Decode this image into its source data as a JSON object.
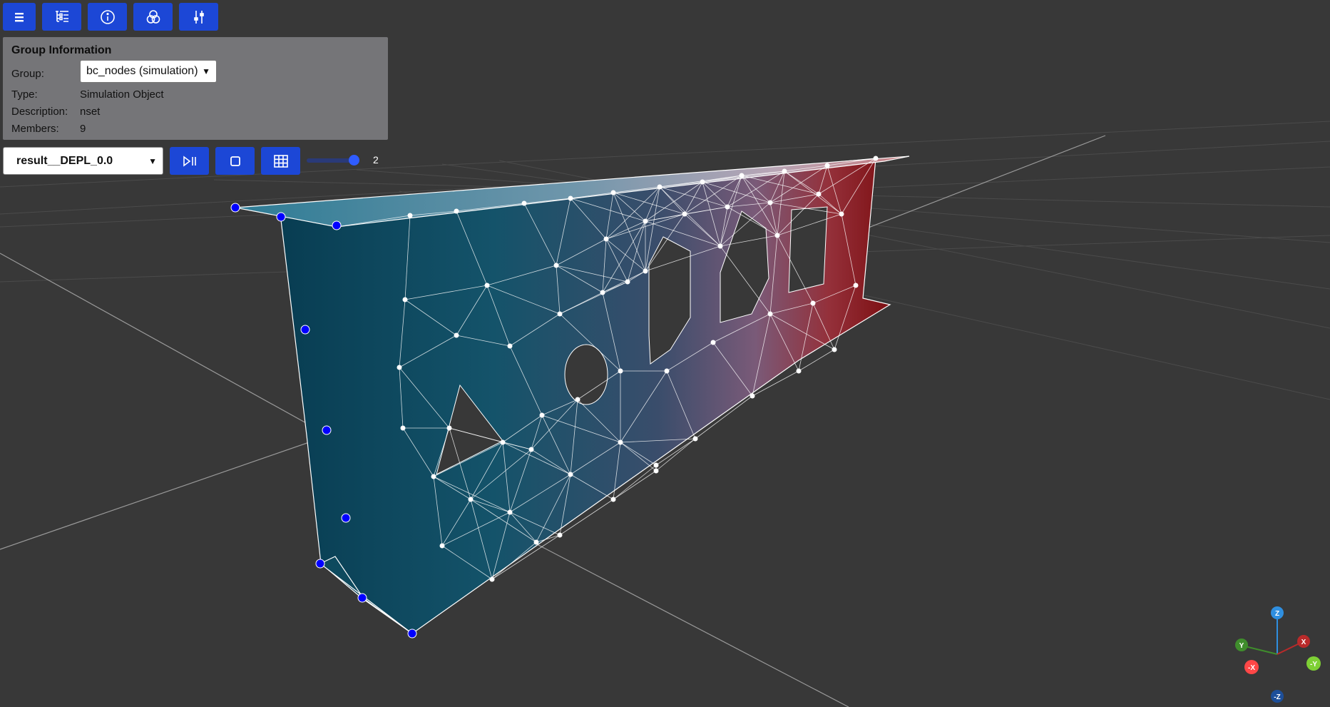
{
  "toolbar": {
    "buttons": [
      {
        "icon": "hamburger-menu-icon"
      },
      {
        "icon": "tree-list-icon"
      },
      {
        "icon": "info-icon"
      },
      {
        "icon": "venn-circles-icon"
      },
      {
        "icon": "sliders-icon"
      }
    ],
    "accent_color": "#1c47d6"
  },
  "group_info": {
    "title": "Group Information",
    "group_label": "Group:",
    "group_value": "bc_nodes (simulation)",
    "type_label": "Type:",
    "type_value": "Simulation Object",
    "description_label": "Description:",
    "description_value": "nset",
    "members_label": "Members:",
    "members_value": "9"
  },
  "result_controls": {
    "result_value": "result__DEPL_0.0",
    "play_pause_icon": "play-pause-icon",
    "stop_icon": "stop-square-icon",
    "grid_icon": "mesh-grid-icon",
    "slider_value": "2"
  },
  "axes_gizmo": {
    "z": "Z",
    "y": "Y",
    "x": "X",
    "neg_x": "-X",
    "neg_y": "-Y",
    "neg_z": "-Z",
    "colors": {
      "z": "#2f8fe0",
      "y": "#3f8d2c",
      "x": "#b92a2a",
      "neg_x": "#ff4747",
      "neg_y": "#7ed035",
      "neg_z": "#1d4f9a"
    }
  },
  "colors": {
    "background": "#383838",
    "mesh_cold": "#0c4f66",
    "mesh_hot": "#8a1010",
    "boundary_node": "#0000ff"
  }
}
